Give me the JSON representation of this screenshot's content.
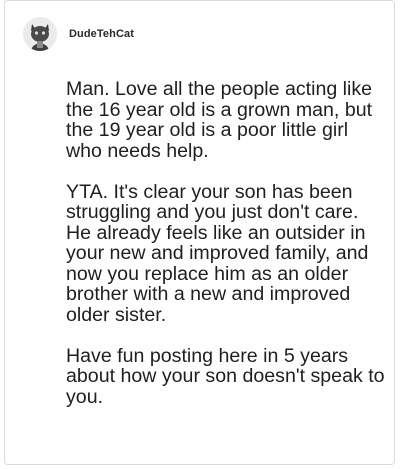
{
  "post": {
    "username": "DudeTehCat",
    "avatar_icon": "cat-avatar-icon",
    "paragraphs": [
      "Man. Love all the people acting like the 16 year old is a grown man, but the 19 year old is a poor little girl who needs help.",
      "YTA. It's clear your son has been struggling and you just don't care. He already feels like an outsider in your new and improved family, and now you replace him as an older brother with a new and improved older sister.",
      "Have fun posting here in 5 years about how your son doesn't speak to you."
    ]
  },
  "colors": {
    "border": "#dcdcdc",
    "text": "#1f1f1f",
    "username": "#2a2a2a"
  }
}
